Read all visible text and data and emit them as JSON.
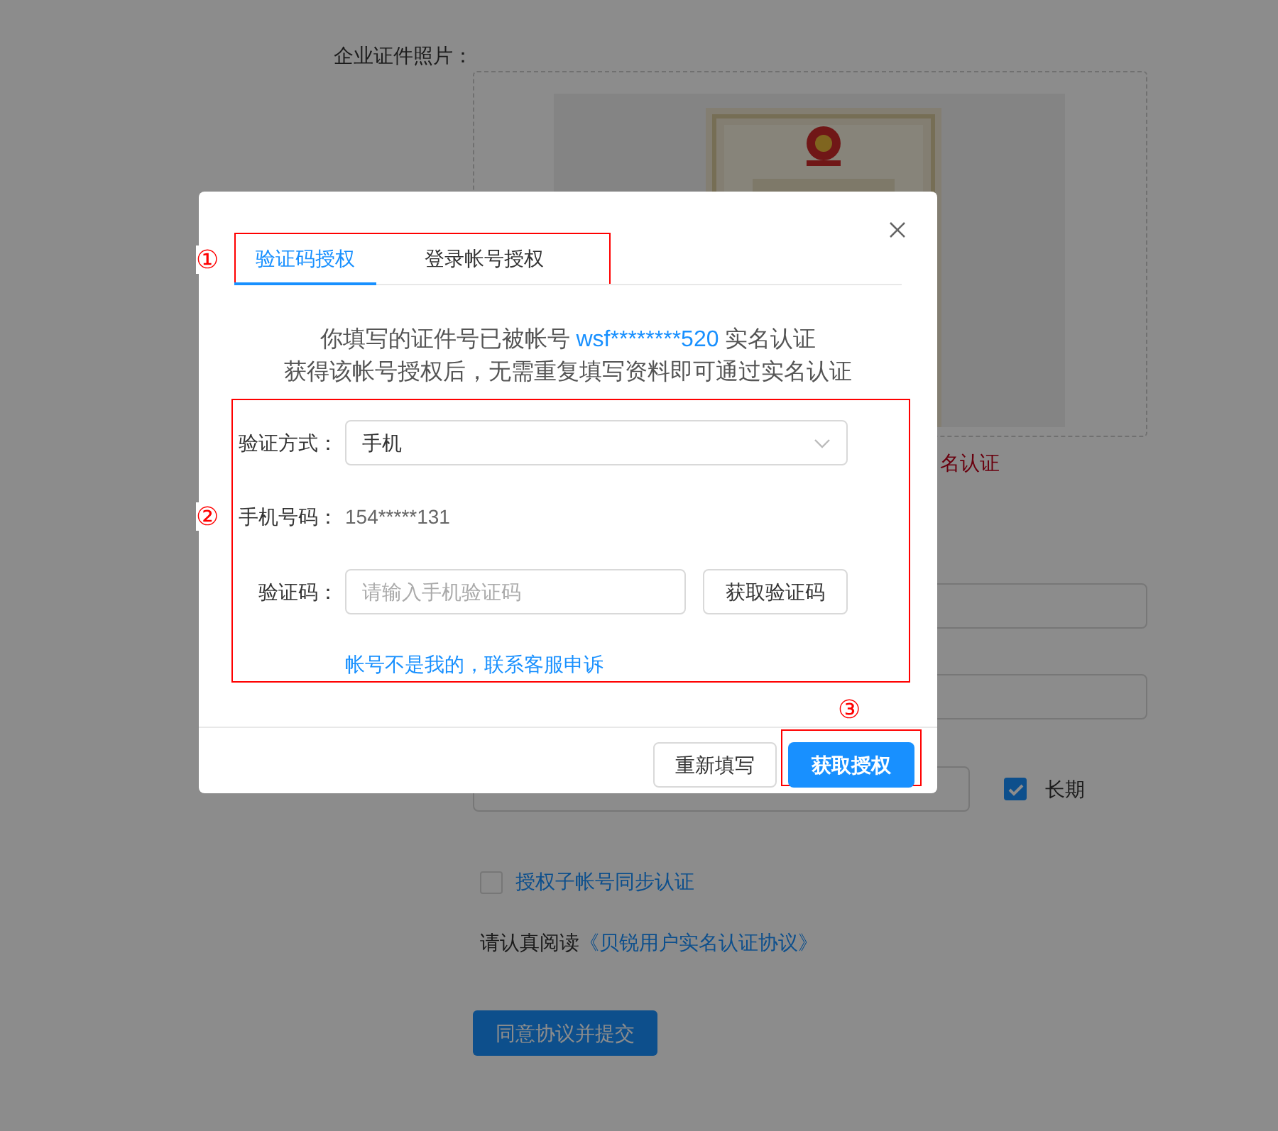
{
  "background_form": {
    "license_label": "企业证件照片：",
    "verification_note": "名认证",
    "long_term": {
      "label": "长期",
      "checked": true
    },
    "sync_subaccounts": {
      "label": "授权子帐号同步认证",
      "checked": false
    },
    "agreement": {
      "prefix": "请认真阅读",
      "link": "《贝锐用户实名认证协议》"
    },
    "submit_button": "同意协议并提交"
  },
  "dialog": {
    "tabs": [
      {
        "label": "验证码授权",
        "selected": true
      },
      {
        "label": "登录帐号授权",
        "selected": false
      }
    ],
    "notice": {
      "line1_prefix": "你填写的证件号已被帐号",
      "account": "wsf********520",
      "line1_suffix": "实名认证",
      "line2": "获得该帐号授权后，无需重复填写资料即可通过实名认证"
    },
    "method_label": "验证方式：",
    "method_value": "手机",
    "phone_label": "手机号码：",
    "phone_value": "154*****131",
    "code_label": "验证码：",
    "code_placeholder": "请输入手机验证码",
    "get_code_button": "获取验证码",
    "appeal_link": "帐号不是我的，联系客服申诉",
    "reset_button": "重新填写",
    "confirm_button": "获取授权"
  },
  "annotations": [
    {
      "label": "①"
    },
    {
      "label": "②"
    },
    {
      "label": "③"
    }
  ]
}
